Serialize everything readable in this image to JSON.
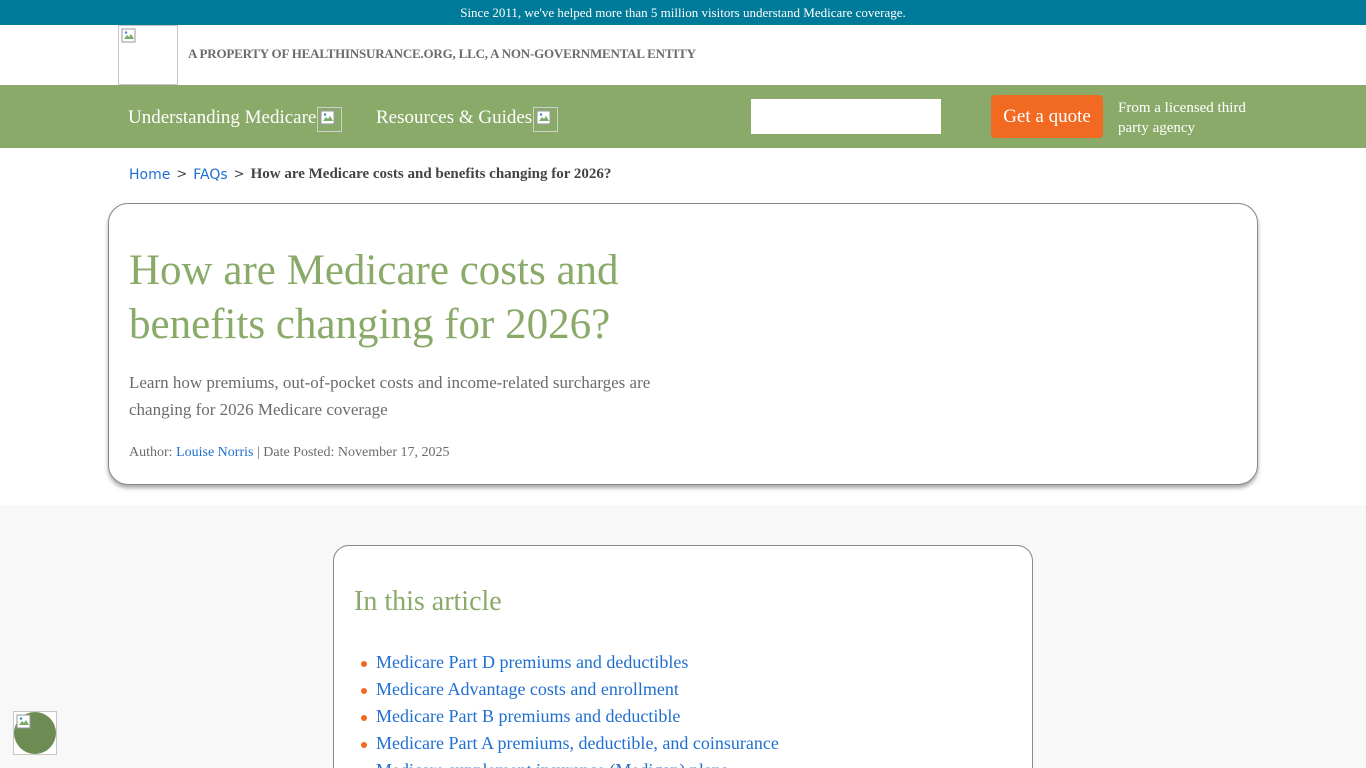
{
  "banner": {
    "text": "Since 2011, we've helped more than 5 million visitors understand Medicare coverage."
  },
  "header": {
    "property_text": "A PROPERTY OF HEALTHINSURANCE.ORG, LLC, A NON-GOVERNMENTAL ENTITY"
  },
  "nav": {
    "items": [
      {
        "label": "Understanding Medicare"
      },
      {
        "label": "Resources & Guides"
      }
    ],
    "search_placeholder": "",
    "quote_label": "Get a quote",
    "licensed_text": "From a licensed third party agency"
  },
  "breadcrumb": {
    "home": "Home",
    "sep": ">",
    "faqs": "FAQs",
    "current": "How are Medicare costs and benefits changing for 2026?"
  },
  "hero": {
    "title": "How are Medicare costs and benefits changing for 2026?",
    "subtitle": "Learn how premiums, out-of-pocket costs and income-related surcharges are changing for 2026 Medicare coverage",
    "author_label": "Author:",
    "author_name": "Louise Norris",
    "date_label": "| Date Posted: November 17, 2025"
  },
  "toc": {
    "title": "In this article",
    "items": [
      "Medicare Part D premiums and deductibles",
      "Medicare Advantage costs and enrollment",
      "Medicare Part B premiums and deductible",
      "Medicare Part A premiums, deductible, and coinsurance",
      "Medicare supplement insurance (Medigap) plans"
    ]
  },
  "colors": {
    "banner": "#007a99",
    "nav": "#89aa68",
    "accent": "#f26a22",
    "link": "#1f6fd1"
  }
}
